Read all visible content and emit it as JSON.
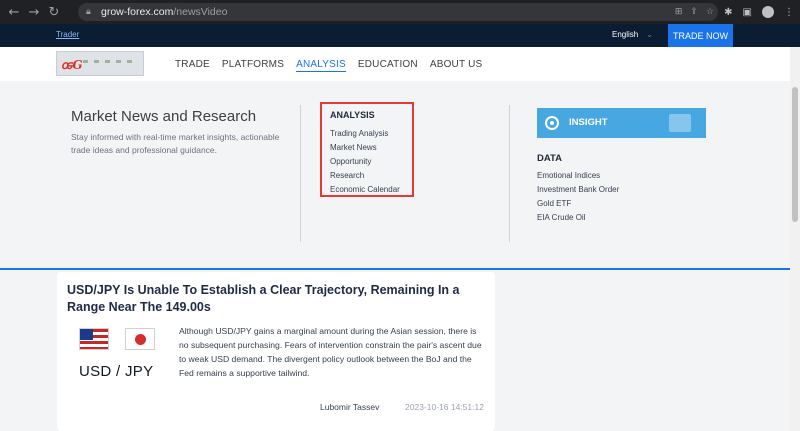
{
  "browser": {
    "url_domain": "grow-forex.com",
    "url_path": "/newsVideo",
    "back_icon": "arrow-left-icon",
    "forward_icon": "arrow-right-icon",
    "reload_icon": "reload-icon"
  },
  "topbar": {
    "trader_link": "Trader",
    "language": "English",
    "trade_now": "TRADE NOW"
  },
  "nav": {
    "items": [
      "TRADE",
      "PLATFORMS",
      "ANALYSIS",
      "EDUCATION",
      "ABOUT US"
    ],
    "active": "ANALYSIS"
  },
  "panel": {
    "title": "Market News and Research",
    "description": "Stay informed with real-time market insights, actionable trade ideas and professional guidance.",
    "analysis": {
      "heading": "ANALYSIS",
      "items": [
        "Trading Analysis",
        "Market News",
        "Opportunity",
        "Research",
        "Economic Calendar"
      ]
    },
    "insight_label": "INSIGHT",
    "data": {
      "heading": "DATA",
      "items": [
        "Emotional Indices",
        "Investment Bank Order",
        "Gold ETF",
        "EIA Crude Oil"
      ]
    }
  },
  "article": {
    "title": "USD/JPY Is Unable To Establish a Clear Trajectory, Remaining In a Range Near The 149.00s",
    "pair_label": "USD / JPY",
    "body": "Although USD/JPY gains a marginal amount during the Asian session, there is no subsequent purchasing. Fears of intervention constrain the pair's ascent due to weak USD demand. The divergent policy outlook between the BoJ and the Fed remains a supportive tailwind.",
    "author": "Lubomir Tassev",
    "date": "2023-10-16 14:51:12"
  },
  "colors": {
    "accent": "#1a73e8",
    "highlight_border": "#e53935",
    "insight_bg": "#47a7e0"
  }
}
